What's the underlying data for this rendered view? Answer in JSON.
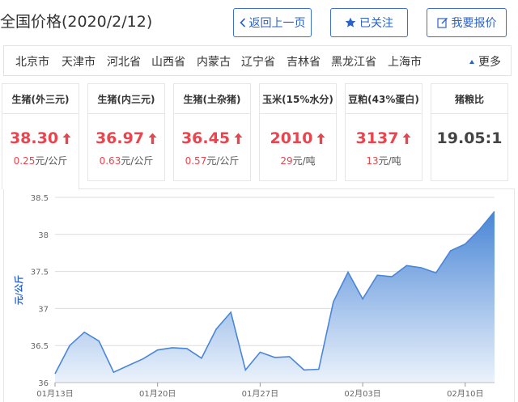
{
  "header": {
    "title": "全国价格(2020/2/12)",
    "buttons": {
      "back": "返回上一页",
      "follow": "已关注",
      "quote": "我要报价"
    }
  },
  "regions": [
    "北京市",
    "天津市",
    "河北省",
    "山西省",
    "内蒙古",
    "辽宁省",
    "吉林省",
    "黑龙江省",
    "上海市"
  ],
  "more_label": "更多",
  "cards": [
    {
      "name": "生猪(外三元)",
      "price": "38.30",
      "change": "0.25",
      "unit": "元/公斤",
      "up": true
    },
    {
      "name": "生猪(内三元)",
      "price": "36.97",
      "change": "0.63",
      "unit": "元/公斤",
      "up": true
    },
    {
      "name": "生猪(土杂猪)",
      "price": "36.45",
      "change": "0.57",
      "unit": "元/公斤",
      "up": true
    },
    {
      "name": "玉米(15%水分)",
      "price": "2010",
      "change": "29",
      "unit": "元/吨",
      "up": true
    },
    {
      "name": "豆粕(43%蛋白)",
      "price": "3137",
      "change": "13",
      "unit": "元/吨",
      "up": true
    },
    {
      "name": "猪粮比",
      "price": "19.05:1",
      "change": "",
      "unit": "",
      "up": false
    }
  ],
  "colors": {
    "accent": "#2c62c8",
    "up": "#e8454e",
    "line": "#4a86d6"
  },
  "chart_data": {
    "type": "area",
    "ylabel": "元/公斤",
    "ylim": [
      36,
      38.5
    ],
    "yticks": [
      "36",
      "36.5",
      "37",
      "37.5",
      "38",
      "38.5"
    ],
    "xticks": [
      "01月13日",
      "01月20日",
      "01月27日",
      "02月03日",
      "02月10日"
    ],
    "x": [
      "2020-01-13",
      "2020-01-14",
      "2020-01-15",
      "2020-01-16",
      "2020-01-17",
      "2020-01-18",
      "2020-01-19",
      "2020-01-20",
      "2020-01-21",
      "2020-01-22",
      "2020-01-23",
      "2020-01-24",
      "2020-01-25",
      "2020-01-26",
      "2020-01-27",
      "2020-01-28",
      "2020-01-29",
      "2020-01-30",
      "2020-01-31",
      "2020-02-01",
      "2020-02-02",
      "2020-02-03",
      "2020-02-04",
      "2020-02-05",
      "2020-02-06",
      "2020-02-07",
      "2020-02-08",
      "2020-02-09",
      "2020-02-10",
      "2020-02-11",
      "2020-02-12"
    ],
    "values": [
      36.12,
      36.5,
      36.68,
      36.56,
      36.14,
      36.23,
      36.32,
      36.44,
      36.47,
      36.46,
      36.33,
      36.72,
      36.95,
      36.17,
      36.41,
      36.34,
      36.35,
      36.17,
      36.18,
      37.09,
      37.49,
      37.13,
      37.45,
      37.43,
      37.58,
      37.55,
      37.48,
      37.78,
      37.87,
      38.07,
      38.31
    ]
  }
}
